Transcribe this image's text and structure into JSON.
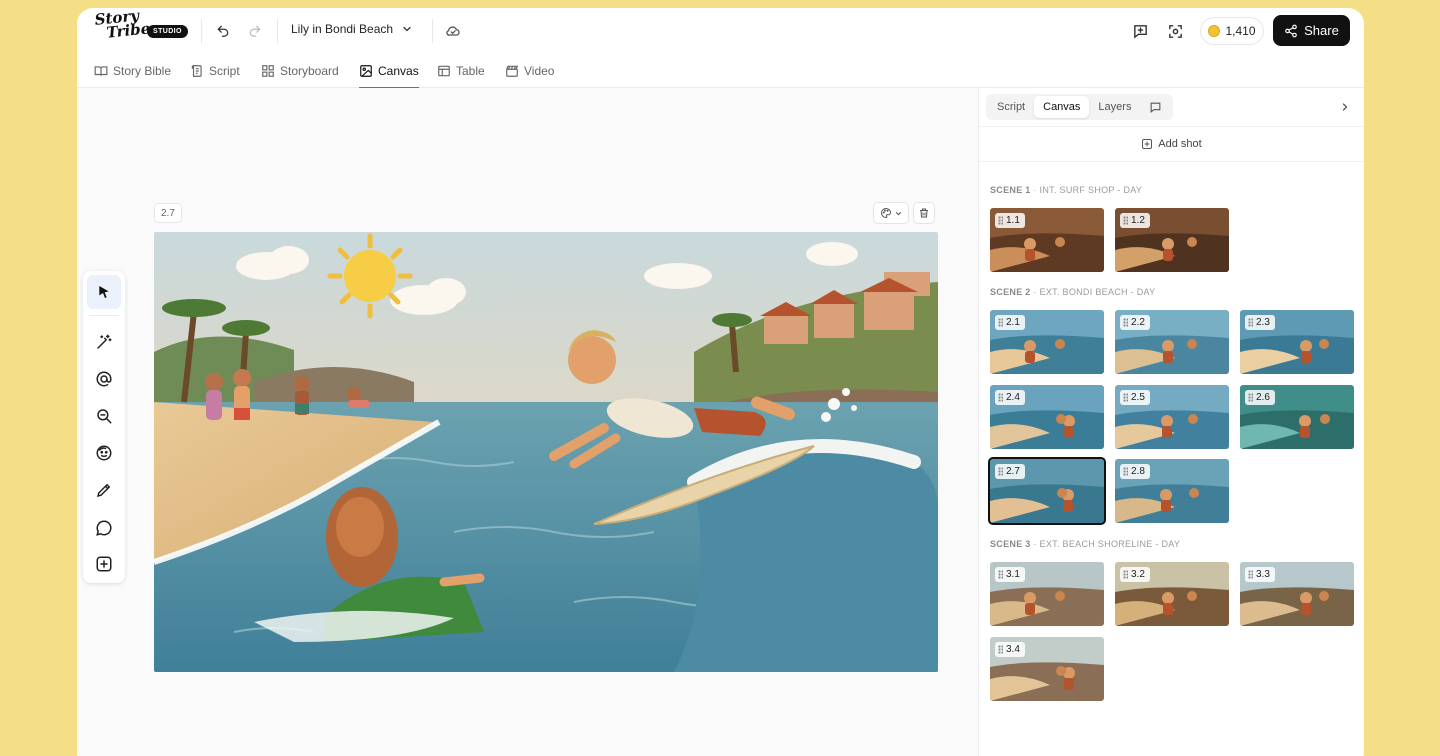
{
  "app": {
    "logo_text": "Story\n  Tribe",
    "logo_badge": "STUDIO",
    "project_title": "Lily in Bondi Beach",
    "coins": "1,410",
    "share_label": "Share"
  },
  "tabs": [
    {
      "label": "Story Bible",
      "icon": "book-icon",
      "active": false
    },
    {
      "label": "Script",
      "icon": "script-icon",
      "active": false
    },
    {
      "label": "Storyboard",
      "icon": "grid-icon",
      "active": false
    },
    {
      "label": "Canvas",
      "icon": "image-icon",
      "active": true
    },
    {
      "label": "Table",
      "icon": "table-icon",
      "active": false
    },
    {
      "label": "Video",
      "icon": "clapper-icon",
      "active": false
    }
  ],
  "canvas": {
    "shot_tag": "2.7"
  },
  "toolbar": [
    "pointer-icon",
    "magic-wand-icon",
    "at-icon",
    "zoom-icon",
    "face-icon",
    "pencil-icon",
    "comment-icon",
    "add-icon"
  ],
  "panel": {
    "tabs": [
      "Script",
      "Canvas",
      "Layers"
    ],
    "active_tab": "Canvas",
    "add_shot_label": "Add shot",
    "scenes": [
      {
        "number": "SCENE 1",
        "heading": " · INT. SURF SHOP - DAY",
        "shots": [
          "1.1",
          "1.2"
        ]
      },
      {
        "number": "SCENE 2",
        "heading": " · EXT. BONDI BEACH - DAY",
        "shots": [
          "2.1",
          "2.2",
          "2.3",
          "2.4",
          "2.5",
          "2.6",
          "2.7",
          "2.8"
        ]
      },
      {
        "number": "SCENE 3",
        "heading": " · EXT. BEACH SHORELINE - DAY",
        "shots": [
          "3.1",
          "3.2",
          "3.3",
          "3.4"
        ]
      }
    ],
    "selected_shot": "2.7"
  },
  "colors": {
    "background": "#f4df86",
    "accent": "#3a7bd5",
    "share_bg": "#111111"
  }
}
